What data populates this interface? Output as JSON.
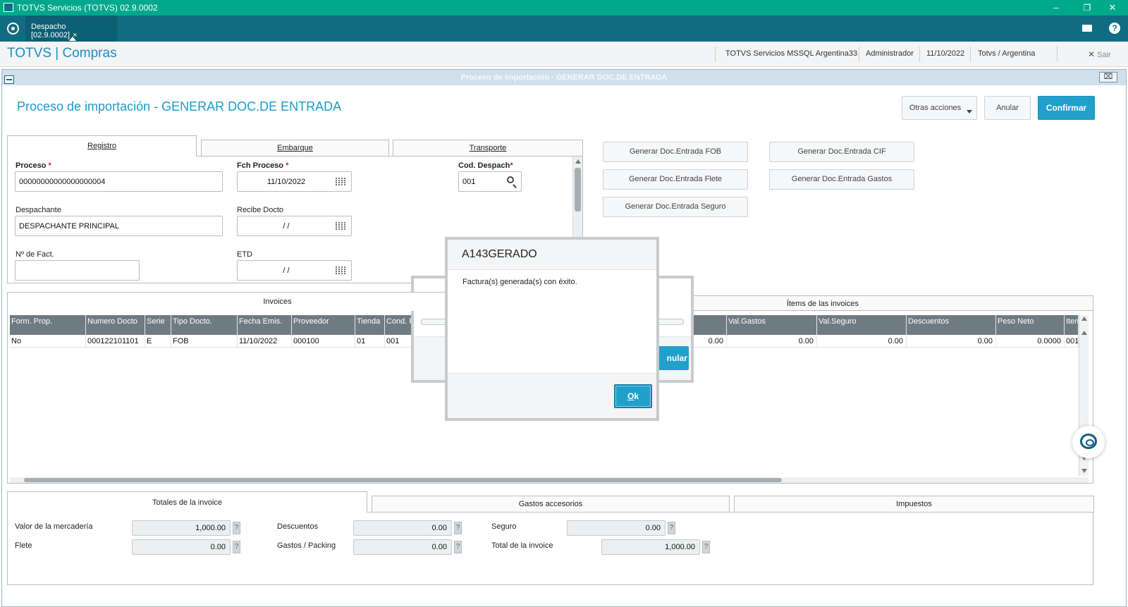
{
  "window": {
    "title": "TOTVS Servicios (TOTVS) 02.9.0002",
    "minimize": "–",
    "maximize": "❐",
    "close": "✕"
  },
  "tabbar": {
    "tab_label": "Despacho [02.9.0002]",
    "tab_close": "×",
    "help": "?"
  },
  "header": {
    "brand": "TOTVS | Compras",
    "environment": "TOTVS Servicios MSSQL Argentina33",
    "user": "Administrador",
    "date": "11/10/2022",
    "company": "Totvs / Argentina",
    "exit_icon": "✕",
    "exit_label": "Sair"
  },
  "form_window": {
    "title": "Proceso de importación - GENERAR DOC.DE ENTRADA",
    "close": "⌧"
  },
  "page": {
    "title": "Proceso de importación - GENERAR DOC.DE ENTRADA"
  },
  "actions": {
    "more": "Otras acciones",
    "cancel": "Anular",
    "confirm": "Confirmar"
  },
  "top_tabs": [
    "Registro",
    "Embarque",
    "Transporte"
  ],
  "fields": {
    "proceso_label": "Proceso",
    "proceso_value": "00000000000000000004",
    "fch_proceso_label": "Fch Proceso",
    "fch_proceso_value": "11/10/2022",
    "cod_despach_label": "Cod. Despach",
    "cod_despach_value": "001",
    "despachante_label": "Despachante",
    "despachante_value": "DESPACHANTE PRINCIPAL",
    "recibe_docto_label": "Recibe Docto",
    "recibe_docto_value": "/ /",
    "nro_fact_label": "Nº de Fact.",
    "nro_fact_value": "",
    "etd_label": "ETD",
    "etd_value": "/ /",
    "required_mark": "*"
  },
  "generate_buttons": {
    "fob": "Generar Doc.Entrada FOB",
    "cif": "Generar Doc.Entrada CIF",
    "flete": "Generar Doc.Entrada Flete",
    "gastos": "Generar Doc.Entrada Gastos",
    "seguro": "Generar Doc.Entrada Seguro"
  },
  "grid_tabs": {
    "invoices": "Invoices",
    "items": "Ítems de las invoices"
  },
  "grid": {
    "columns": [
      "Form. Prop.",
      "Numero Docto",
      "Serie",
      "Tipo Docto.",
      "Fecha Emis.",
      "Proveedor",
      "Tienda",
      "Cond. P",
      "Val.Gastos",
      "Val.Seguro",
      "Descuentos",
      "Peso Neto",
      "Item"
    ],
    "row": {
      "form_prop": "No",
      "numero_docto": "000122101101",
      "serie": "E",
      "tipo_docto": "FOB",
      "fecha_emis": "11/10/2022",
      "proveedor": "000100",
      "tienda": "01",
      "cond": "001",
      "hidden_val": "0.00",
      "val_gastos": "0.00",
      "val_seguro": "0.00",
      "descuentos": "0.00",
      "peso_neto": "0.0000",
      "item": "001"
    }
  },
  "bottom_tabs": [
    "Totales de la invoice",
    "Gastos accesorios",
    "Impuestos"
  ],
  "totals": {
    "valor_mercaderia_label": "Valor de la mercadería",
    "valor_mercaderia": "1,000.00",
    "flete_label": "Flete",
    "flete": "0.00",
    "descuentos_label": "Descuentos",
    "descuentos": "0.00",
    "gastos_packing_label": "Gastos / Packing",
    "gastos_packing": "0.00",
    "seguro_label": "Seguro",
    "seguro": "0.00",
    "total_invoice_label": "Total de la invoice",
    "total_invoice": "1,000.00",
    "help_mark": "?"
  },
  "bg_dialog": {
    "button_fragment": "nular"
  },
  "dialog": {
    "title": "A143GERADO",
    "message": "Factura(s) generada(s) con éxito.",
    "ok_mnemonic": "O",
    "ok_rest": "k"
  }
}
